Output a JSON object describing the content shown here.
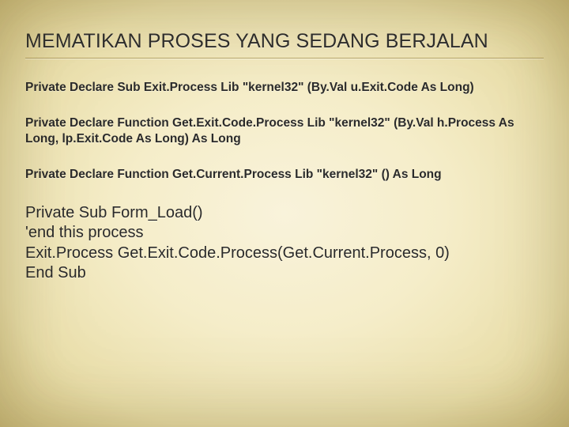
{
  "title": "MEMATIKAN PROSES YANG SEDANG BERJALAN",
  "declarations": [
    "Private Declare Sub Exit.Process Lib \"kernel32\" (By.Val u.Exit.Code As Long)",
    "Private Declare Function Get.Exit.Code.Process Lib \"kernel32\" (By.Val h.Process As Long, lp.Exit.Code As Long) As Long",
    "Private Declare Function Get.Current.Process Lib \"kernel32\" () As Long"
  ],
  "code_lines": [
    "Private Sub Form_Load()",
    "'end this process",
    "Exit.Process Get.Exit.Code.Process(Get.Current.Process, 0)",
    "End Sub"
  ]
}
